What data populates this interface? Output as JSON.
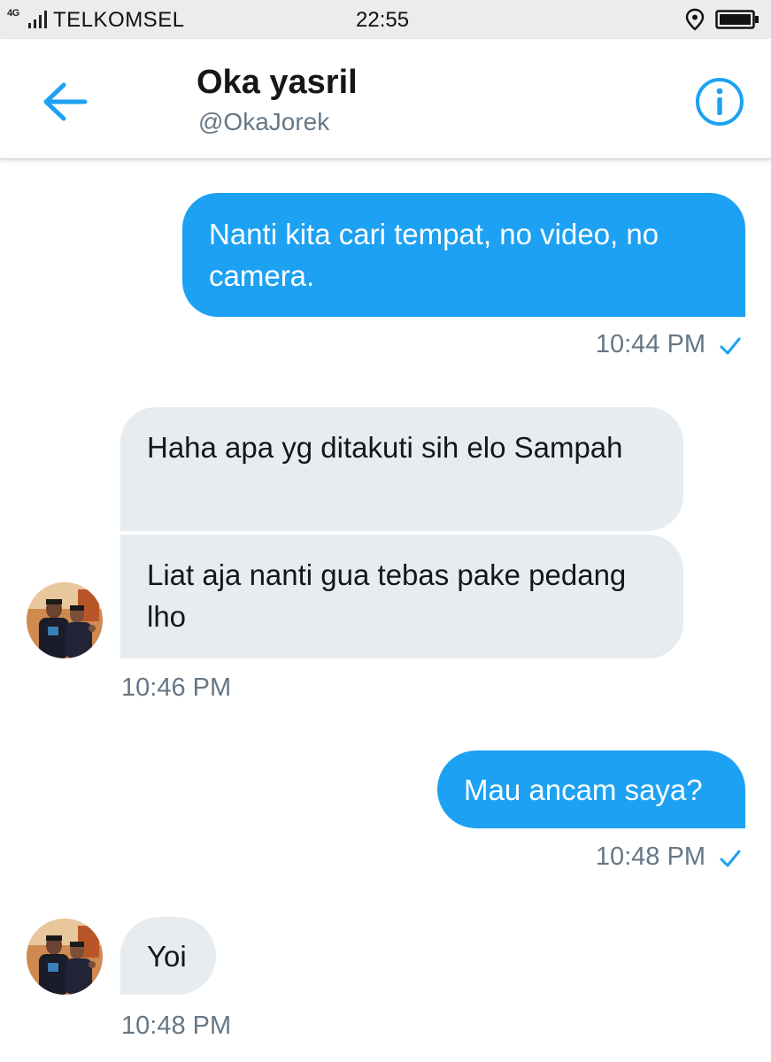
{
  "status_bar": {
    "network": "4G",
    "carrier": "TELKOMSEL",
    "time": "22:55",
    "icons": [
      "signal-icon",
      "location-icon",
      "battery-icon"
    ]
  },
  "header": {
    "name": "Oka yasril",
    "handle": "@OkaJorek",
    "back_icon": "arrow-left-icon",
    "info_icon": "info-circle-icon"
  },
  "colors": {
    "accent": "#1da1f2",
    "incoming_bubble": "#e6ecf0",
    "timestamp": "#657786"
  },
  "messages": [
    {
      "direction": "outgoing",
      "text": "Nanti kita cari tempat, no video, no camera.",
      "time": "10:44 PM",
      "status_icon": "check-icon"
    },
    {
      "direction": "incoming",
      "text": "Haha apa yg ditakuti sih elo Sampah"
    },
    {
      "direction": "incoming",
      "text": "Liat aja nanti gua tebas pake pedang lho",
      "time": "10:46 PM"
    },
    {
      "direction": "outgoing",
      "text": "Mau ancam saya?",
      "time": "10:48 PM",
      "status_icon": "check-icon"
    },
    {
      "direction": "incoming",
      "text": "Yoi",
      "time": "10:48 PM"
    }
  ]
}
